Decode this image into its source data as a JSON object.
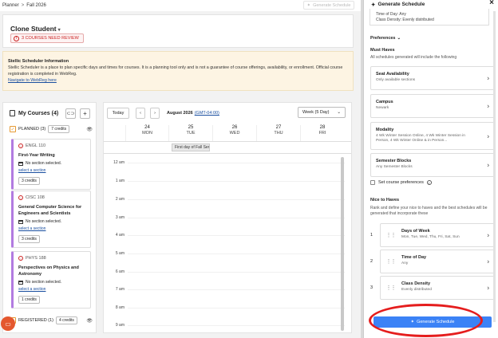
{
  "topbar": {
    "crumb_planner": "Planner",
    "crumb_sep": ">",
    "crumb_term": "Fall 2026",
    "generate_label": "Generate Schedule"
  },
  "header": {
    "student": "Clone Student",
    "review_badge": "3 COURSES NEED REVIEW"
  },
  "info": {
    "title": "Stellic Scheduler Information",
    "body": "Stellic Scheduler is a place to plan specific days and times for courses. It is a planning tool only and is not a guarantee of course offerings, availability, or enrollment. Official course registration is completed in WebReg.",
    "link": "Navigate to WebReg here"
  },
  "courses": {
    "title": "My Courses (4)",
    "planned_label": "PLANNED (3)",
    "planned_credits": "7 credits",
    "items": [
      {
        "code": "ENGL 110",
        "name": "First-Year Writing",
        "section": "No section selected.",
        "select": "select a section",
        "credits": "3 credits"
      },
      {
        "code": "CISC 108",
        "name": "General Computer Science for Engineers and Scientists",
        "section": "No section selected.",
        "select": "select a section",
        "credits": "3 credits"
      },
      {
        "code": "PHYS 188",
        "name": "Perspectives on Physics and Astronomy",
        "section": "No section selected.",
        "select": "select a section",
        "credits": "1 credits"
      }
    ],
    "registered_label": "REGISTERED (1)",
    "registered_credits": "4 credits"
  },
  "calendar": {
    "today": "Today",
    "month": "August 2026",
    "tz": "(GMT-04:00)",
    "view": "Week (5 Day)",
    "days": [
      {
        "num": "24",
        "name": "MON"
      },
      {
        "num": "25",
        "name": "TUE"
      },
      {
        "num": "26",
        "name": "WED"
      },
      {
        "num": "27",
        "name": "THU"
      },
      {
        "num": "28",
        "name": "FRI"
      }
    ],
    "event": "First day of Fall Sem",
    "hours": [
      "12 am",
      "1 am",
      "2 am",
      "3 am",
      "4 am",
      "5 am",
      "6 am",
      "7 am",
      "8 am",
      "9 am"
    ]
  },
  "drawer": {
    "title": "Generate Schedule",
    "prev_line1": "Time of Day: Any",
    "prev_line2": "Class Density: Evenly distributed",
    "preferences": "Preferences",
    "must_title": "Must Haves",
    "must_sub": "All schedules generated will include the following",
    "must": [
      {
        "title": "Seat Availability",
        "sub": "Only available sections"
      },
      {
        "title": "Campus",
        "sub": "Newark"
      },
      {
        "title": "Modality",
        "sub": "4 Wk Winter Session Online, 4 Wk Winter Session in Person, 4 Wk Winter Online & in Person..."
      },
      {
        "title": "Semester Blocks",
        "sub": "Any Semester Blocks"
      }
    ],
    "set_prefs": "Set course preferences",
    "nice_title": "Nice to Haves",
    "nice_sub": "Rank and define your nice to haves and the best schedules will be generated that incorporate these",
    "nice": [
      {
        "num": "1",
        "title": "Days of Week",
        "sub": "Mon, Tue, Wed, Thu, Fri, Sat, Sun"
      },
      {
        "num": "2",
        "title": "Time of Day",
        "sub": "Any"
      },
      {
        "num": "3",
        "title": "Class Density",
        "sub": "Evenly distributed"
      }
    ],
    "generate_button": "Generate Schedule"
  }
}
